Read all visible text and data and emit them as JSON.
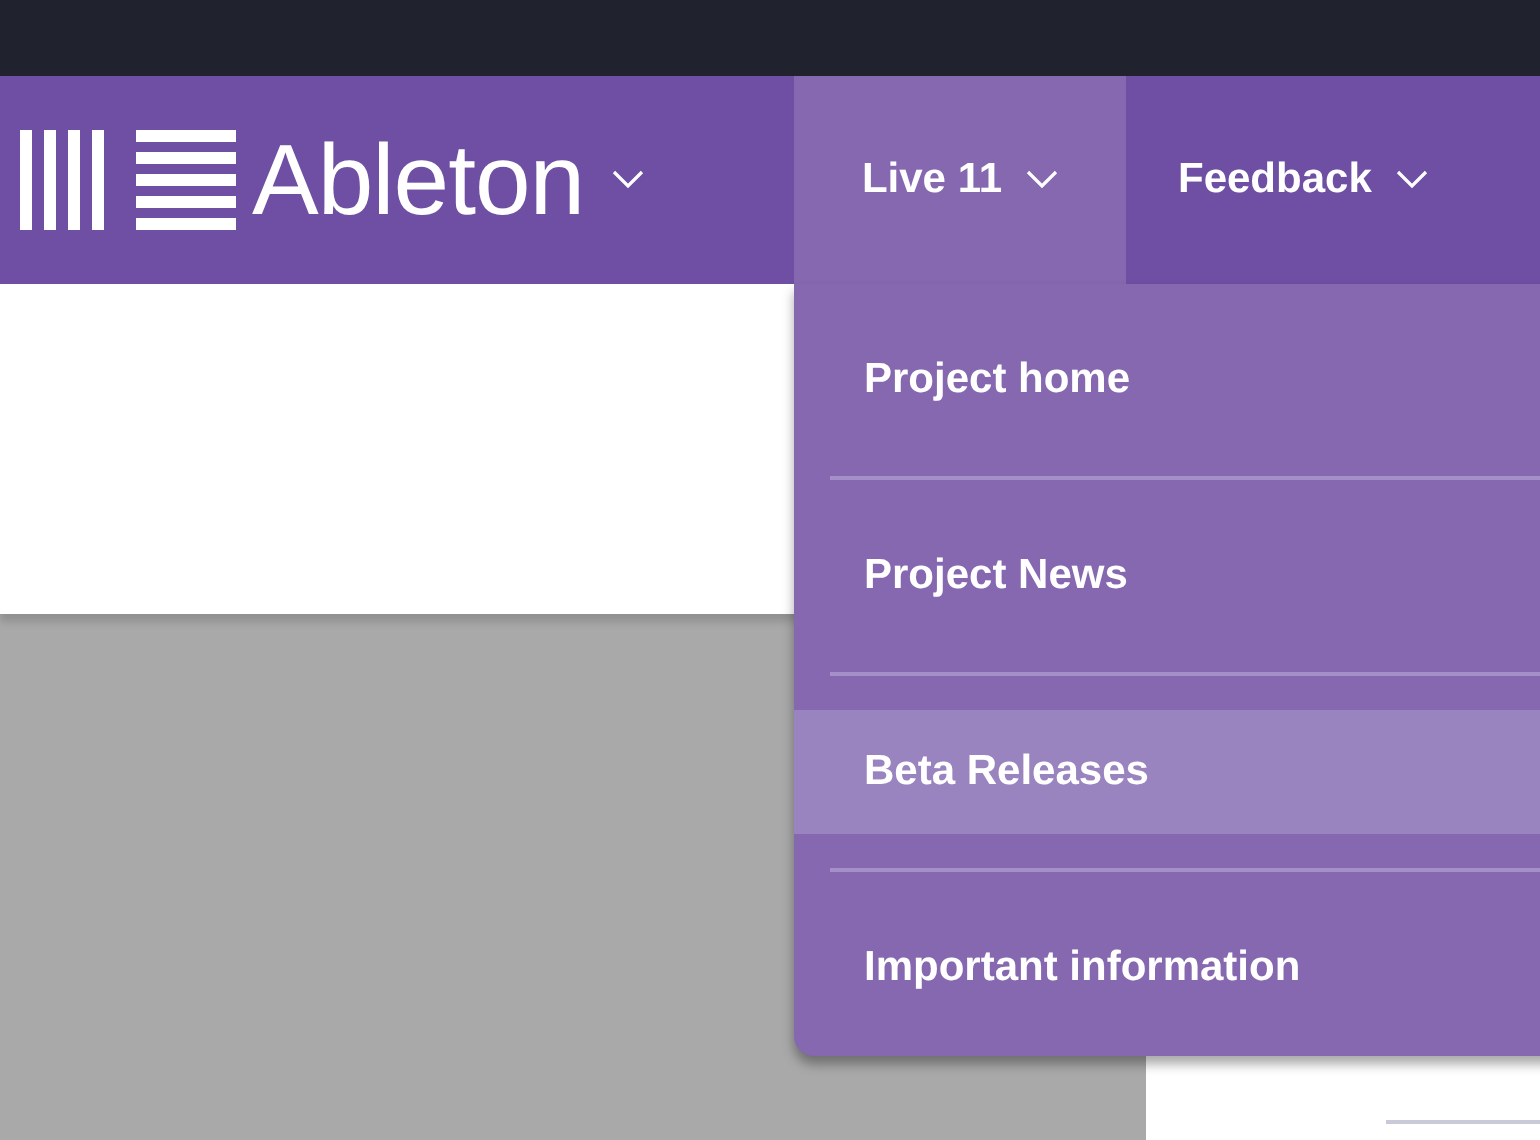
{
  "navbar": {
    "brand": "Ableton",
    "tabs": [
      {
        "label": "Live 11",
        "selected": true
      },
      {
        "label": "Feedback",
        "selected": false
      }
    ]
  },
  "dropdown": {
    "items": [
      {
        "label": "Project home",
        "selected": false
      },
      {
        "label": "Project News",
        "selected": false
      },
      {
        "label": "Beta Releases",
        "selected": true
      },
      {
        "label": "Important information",
        "selected": false
      }
    ]
  }
}
